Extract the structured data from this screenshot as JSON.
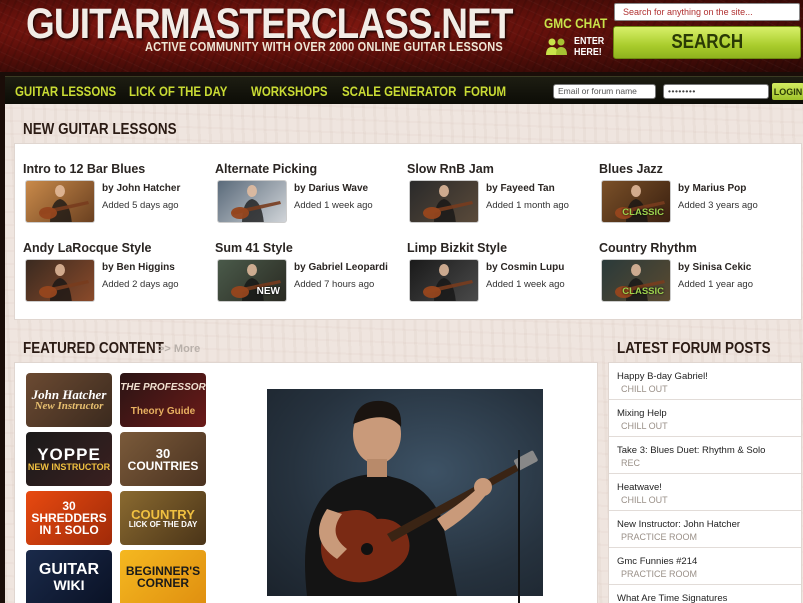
{
  "header": {
    "logo": "GUITARMASTERCLASS.NET",
    "tagline": "ACTIVE COMMUNITY WITH OVER 2000 ONLINE GUITAR LESSONS",
    "chat_label": "GMC CHAT",
    "chat_enter_1": "ENTER",
    "chat_enter_2": "HERE!",
    "search_placeholder": "Search for anything on the site...",
    "search_button": "SEARCH"
  },
  "nav": {
    "items": [
      "GUITAR LESSONS",
      "LICK OF THE DAY",
      "WORKSHOPS",
      "SCALE GENERATOR",
      "FORUM"
    ],
    "email_placeholder": "Email or forum name",
    "password_value": "••••••••",
    "login_label": "LOGIN"
  },
  "lessons": {
    "title": "NEW GUITAR LESSONS",
    "items": [
      {
        "title": "Intro to 12 Bar Blues",
        "author": "by John Hatcher",
        "added": "Added 5 days ago",
        "badge": ""
      },
      {
        "title": "Alternate Picking",
        "author": "by Darius Wave",
        "added": "Added 1 week ago",
        "badge": ""
      },
      {
        "title": "Slow RnB Jam",
        "author": "by Fayeed Tan",
        "added": "Added 1 month ago",
        "badge": ""
      },
      {
        "title": "Blues Jazz",
        "author": "by Marius Pop",
        "added": "Added 3 years ago",
        "badge": "CLASSIC"
      },
      {
        "title": "Andy LaRocque Style",
        "author": "by Ben Higgins",
        "added": "Added 2 days ago",
        "badge": ""
      },
      {
        "title": "Sum 41 Style",
        "author": "by Gabriel Leopardi",
        "added": "Added 7 hours ago",
        "badge": "NEW"
      },
      {
        "title": "Limp Bizkit Style",
        "author": "by Cosmin Lupu",
        "added": "Added 1 week ago",
        "badge": ""
      },
      {
        "title": "Country Rhythm",
        "author": "by Sinisa Cekic",
        "added": "Added 1 year ago",
        "badge": "CLASSIC"
      }
    ]
  },
  "featured": {
    "title": "FEATURED CONTENT",
    "more": ">> More",
    "tiles": [
      {
        "line1": "John Hatcher",
        "line2": "New Instructor"
      },
      {
        "line1": "THE PROFESSOR",
        "line2": "Theory Guide"
      },
      {
        "line1": "YOPPE",
        "line2": "NEW INSTRUCTOR"
      },
      {
        "line1": "30",
        "line2": "COUNTRIES"
      },
      {
        "line1": "30 SHREDDERS",
        "line2": "IN 1 SOLO"
      },
      {
        "line1": "COUNTRY",
        "line2": "LICK OF THE DAY"
      },
      {
        "line1": "GUITAR",
        "line2": "WIKI"
      },
      {
        "line1": "BEGINNER'S",
        "line2": "CORNER"
      }
    ]
  },
  "forum": {
    "title": "LATEST FORUM POSTS",
    "posts": [
      {
        "title": "Happy B-day Gabriel!",
        "category": "CHILL OUT"
      },
      {
        "title": "Mixing Help",
        "category": "CHILL OUT"
      },
      {
        "title": "Take 3: Blues Duet: Rhythm & Solo",
        "category": "REC"
      },
      {
        "title": "Heatwave!",
        "category": "CHILL OUT"
      },
      {
        "title": "New Instructor: John Hatcher",
        "category": "PRACTICE ROOM"
      },
      {
        "title": "Gmc Funnies #214",
        "category": "PRACTICE ROOM"
      },
      {
        "title": "What Are Time Signatures",
        "category": ""
      }
    ]
  },
  "colors": {
    "accent_green": "#c9db34",
    "header_red": "#6a120c",
    "nav_bg": "#141409"
  }
}
